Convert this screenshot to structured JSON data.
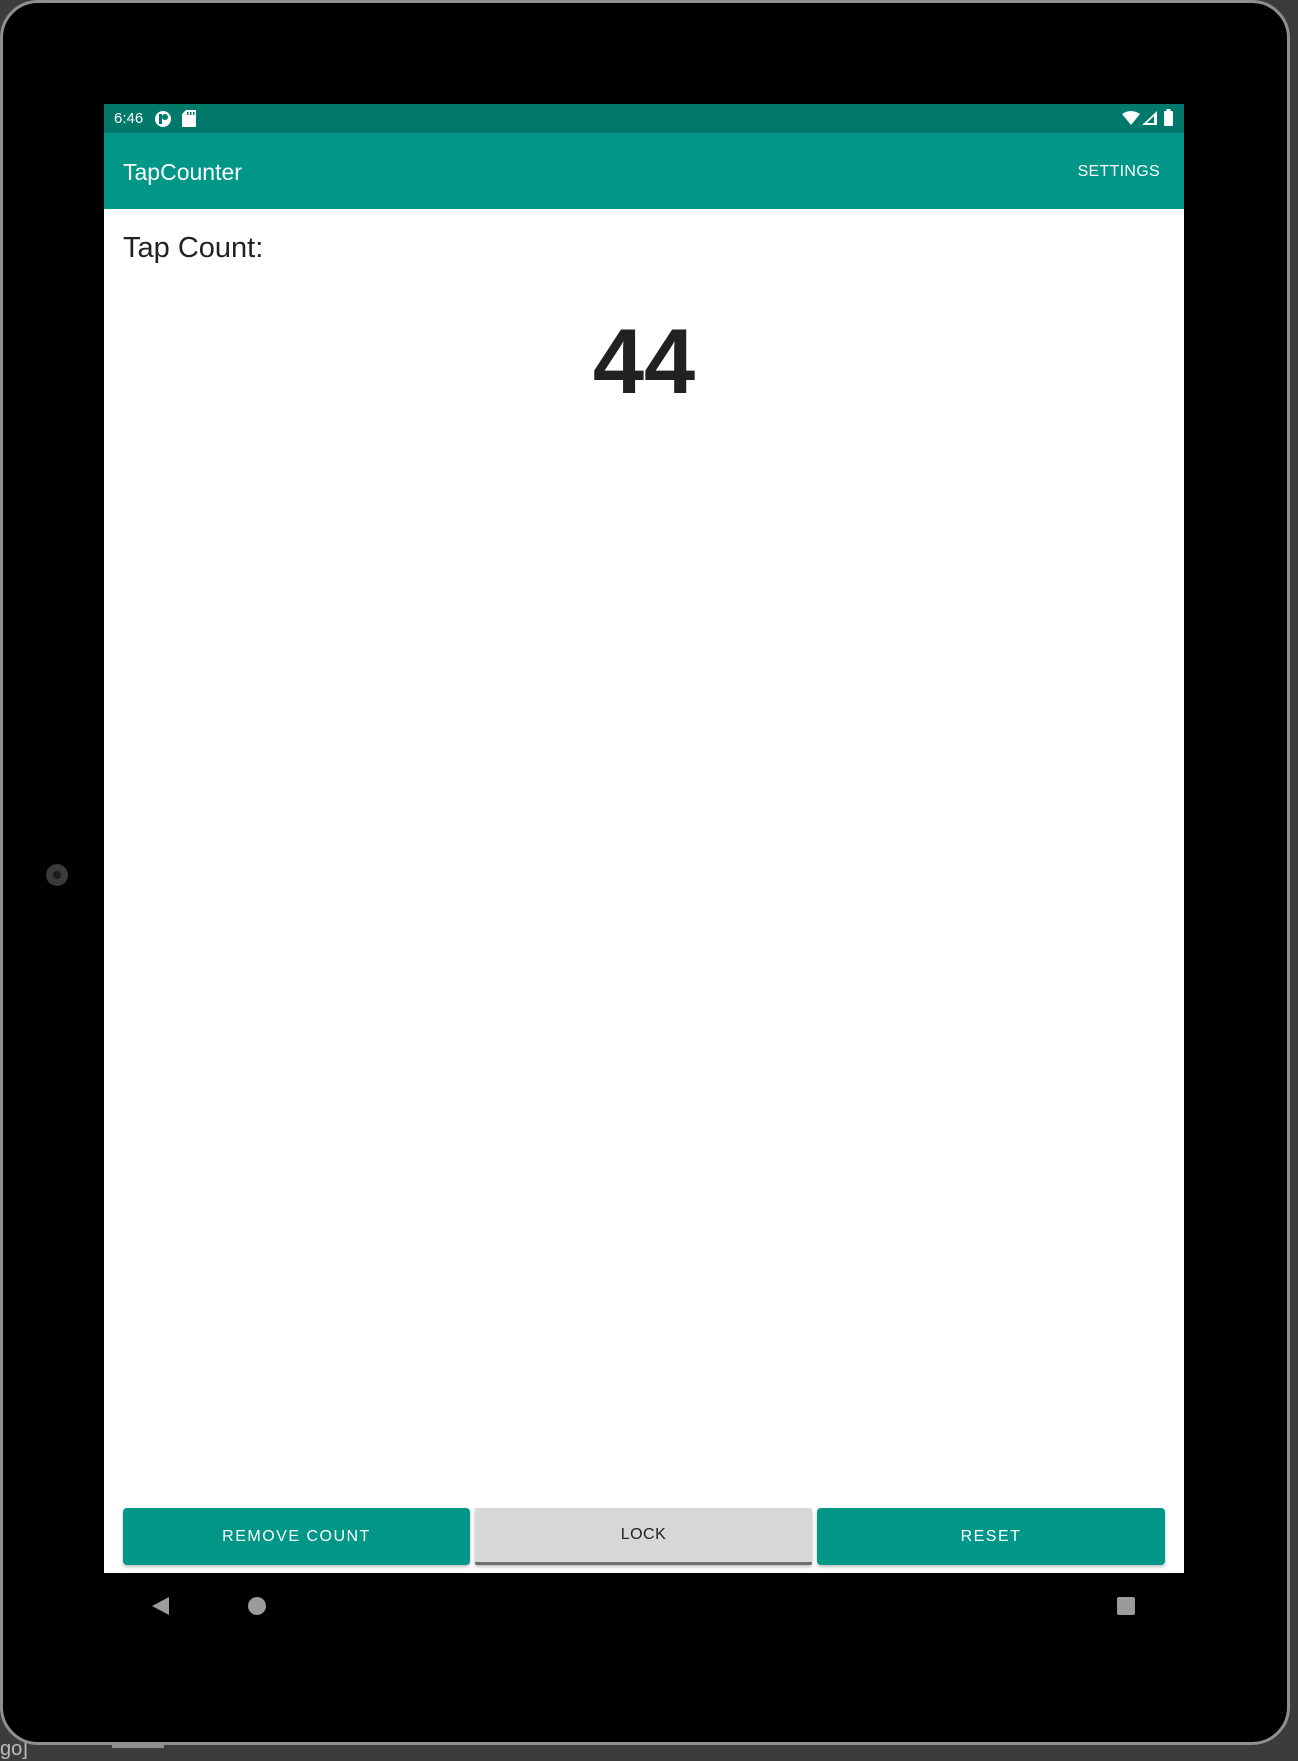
{
  "status_bar": {
    "time": "6:46",
    "left_icons": [
      "play-protect-icon",
      "sd-card-icon"
    ],
    "right_icons": [
      "wifi-icon",
      "cell-signal-icon",
      "battery-icon"
    ]
  },
  "app_bar": {
    "title": "TapCounter",
    "settings_label": "SETTINGS"
  },
  "main": {
    "tap_count_label": "Tap Count:",
    "count_value": "44"
  },
  "buttons": {
    "remove_count": "REMOVE COUNT",
    "lock": "LOCK",
    "reset": "RESET"
  },
  "colors": {
    "primary": "#009688",
    "primary_dark": "#00796b",
    "lock_button": "#d6d7d7"
  },
  "nav_bar": {
    "icons": [
      "back-icon",
      "home-icon",
      "recents-icon"
    ]
  },
  "background": {
    "fragment_text": "go]"
  }
}
